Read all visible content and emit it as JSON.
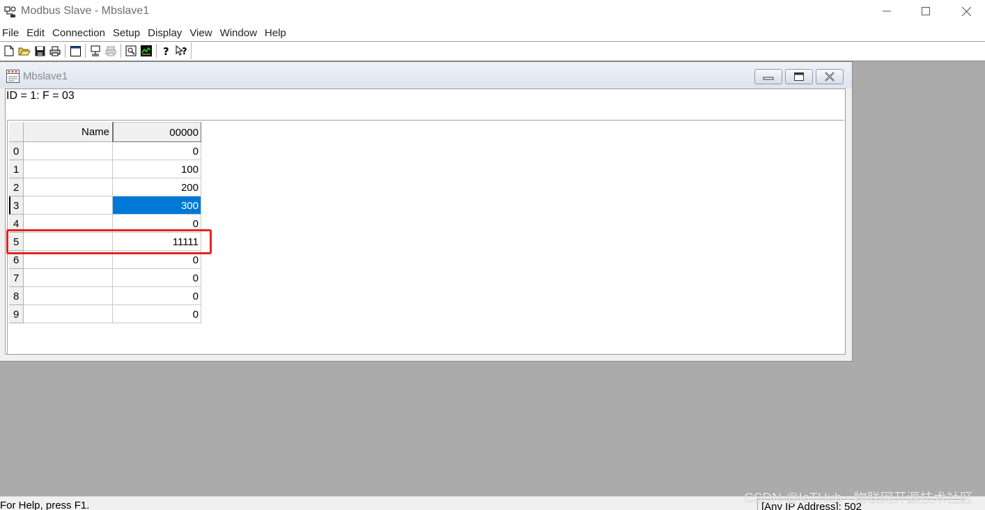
{
  "app": {
    "title": "Modbus Slave - Mbslave1"
  },
  "menu": [
    "File",
    "Edit",
    "Connection",
    "Setup",
    "Display",
    "View",
    "Window",
    "Help"
  ],
  "toolbar": {
    "icons": [
      "new-icon",
      "open-icon",
      "save-icon",
      "print-icon",
      "window-icon",
      "connect-icon",
      "disconnect-icon",
      "monitor-icon",
      "traffic-icon",
      "help-icon",
      "context-help-icon"
    ]
  },
  "child_window": {
    "title": "Mbslave1",
    "header": "ID = 1: F = 03",
    "grid": {
      "columns": [
        "Name",
        "00000"
      ],
      "rows": [
        {
          "index": "0",
          "name": "",
          "value": "0"
        },
        {
          "index": "1",
          "name": "",
          "value": "100"
        },
        {
          "index": "2",
          "name": "",
          "value": "200"
        },
        {
          "index": "3",
          "name": "",
          "value": "300"
        },
        {
          "index": "4",
          "name": "",
          "value": "0"
        },
        {
          "index": "5",
          "name": "",
          "value": "11111"
        },
        {
          "index": "6",
          "name": "",
          "value": "0"
        },
        {
          "index": "7",
          "name": "",
          "value": "0"
        },
        {
          "index": "8",
          "name": "",
          "value": "0"
        },
        {
          "index": "9",
          "name": "",
          "value": "0"
        }
      ],
      "selected_row": 3,
      "highlighted_row": 5
    }
  },
  "status": {
    "left": "For Help, press F1.",
    "right": "[Any IP Address]: 502"
  },
  "watermark": "CSDN @IoTHub - 物联网开源技术社区",
  "colors": {
    "selection": "#0078d7",
    "highlight": "#e52222",
    "workspace": "#ababab"
  }
}
